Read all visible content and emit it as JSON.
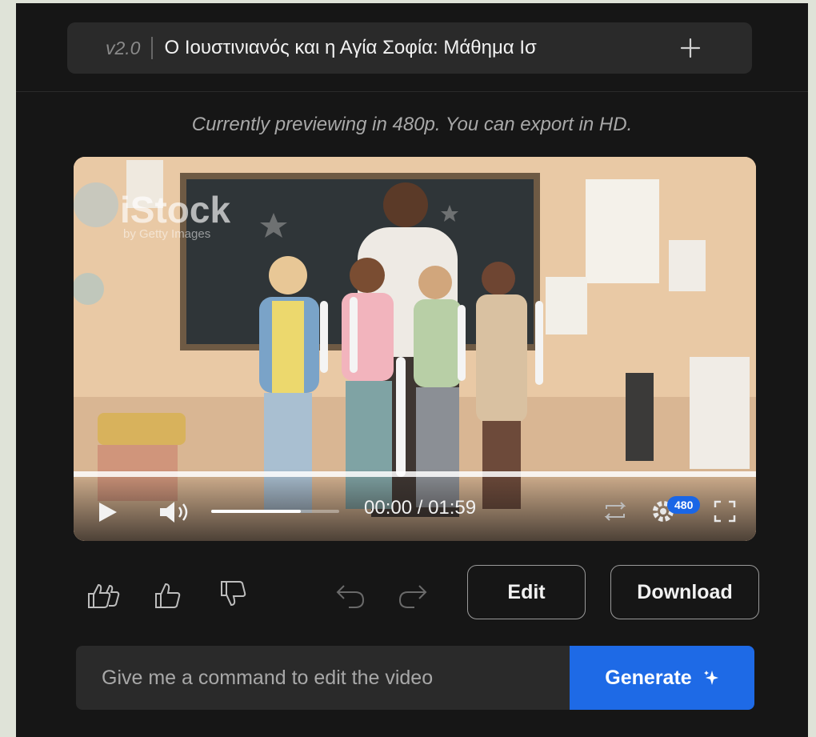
{
  "header": {
    "version": "v2.0",
    "project_title": "Ο Ιουστινιανός και η Αγία Σοφία: Μάθημα Ισ"
  },
  "preview_note": "Currently previewing in 480p. You can export in HD.",
  "video": {
    "watermark_main": "iStock",
    "watermark_sub": "by Getty Images",
    "time_display": "00:00 / 01:59",
    "quality_badge": "480",
    "volume_level": 0.7,
    "progress": 0.0
  },
  "toolbar": {
    "edit_label": "Edit",
    "download_label": "Download"
  },
  "command": {
    "placeholder": "Give me a command to edit the video",
    "generate_label": "Generate"
  },
  "icons": [
    "thumbs-up-double-icon",
    "thumbs-up-icon",
    "thumbs-down-icon",
    "undo-icon",
    "redo-icon",
    "play-icon",
    "volume-icon",
    "loop-icon",
    "settings-icon",
    "fullscreen-icon",
    "plus-icon",
    "sparkle-icon"
  ],
  "colors": {
    "accent": "#1e6ae6",
    "panel": "#161616",
    "surface": "#2a2a2a"
  }
}
